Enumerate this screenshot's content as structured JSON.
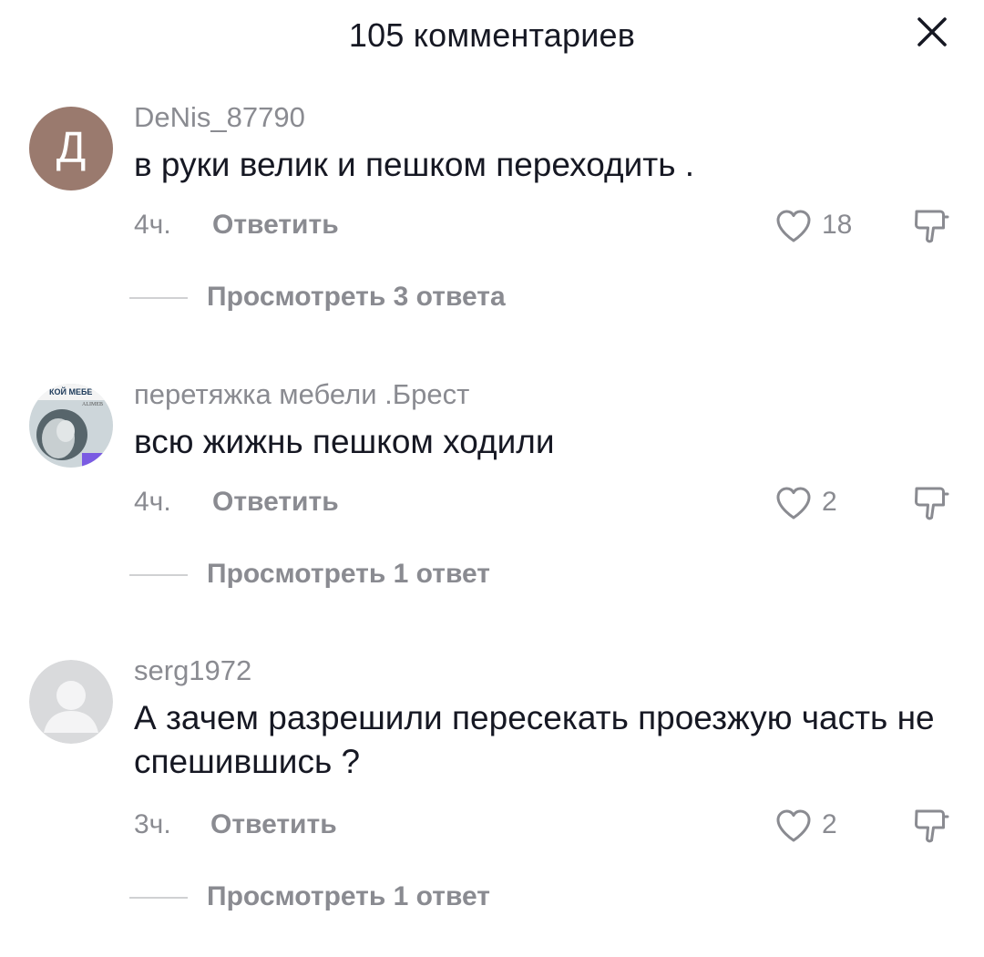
{
  "header": {
    "title": "105 комментариев",
    "close_icon": "close-icon"
  },
  "comments": [
    {
      "avatar_letter": "Д",
      "avatar_color": "#9a7a6e",
      "username": "DeNis_87790",
      "text": "в руки велик и пешком переходить .",
      "time": "4ч.",
      "reply_label": "Ответить",
      "likes": "18",
      "view_replies": "Просмотреть 3 ответа"
    },
    {
      "avatar_image": "furniture-shop-avatar",
      "avatar_text_top": "КОЙ МЕБЕ",
      "avatar_text_mid": "ALIMEB",
      "username": "перетяжка мебели .Брест",
      "text": "всю жижнь пешком ходили",
      "time": "4ч.",
      "reply_label": "Ответить",
      "likes": "2",
      "view_replies": "Просмотреть 1 ответ"
    },
    {
      "avatar_image": "default-user-avatar",
      "username": "serg1972",
      "text": "А зачем разрешили пересекать проезжую часть не спешившись ?",
      "time": "3ч.",
      "reply_label": "Ответить",
      "likes": "2",
      "view_replies": "Просмотреть 1 ответ"
    }
  ],
  "colors": {
    "text_primary": "#161823",
    "text_secondary": "#8a8b91",
    "divider": "#d0d1d3",
    "background": "#ffffff"
  }
}
